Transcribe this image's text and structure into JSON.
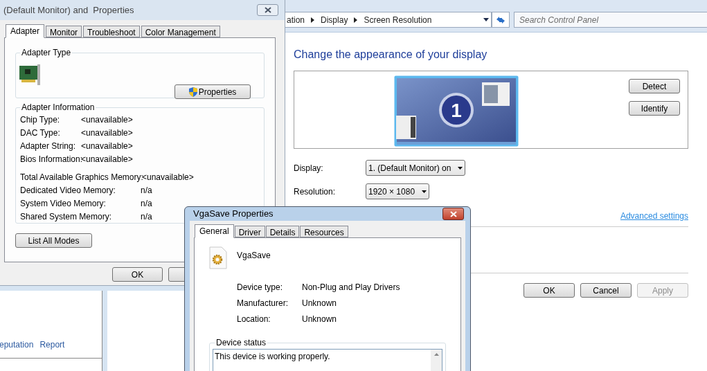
{
  "control_panel": {
    "breadcrumb": [
      "ation",
      "Display",
      "Screen Resolution"
    ],
    "search": {
      "placeholder": "Search Control Panel"
    },
    "heading": "Change the appearance of your display",
    "monitor": {
      "number": "1"
    },
    "side_buttons": [
      "Detect",
      "Identify"
    ],
    "fields": [
      {
        "label": "Display:",
        "value": "1. (Default Monitor) on"
      },
      {
        "label": "Resolution:",
        "value": "1920 × 1080"
      }
    ],
    "link": "Advanced settings",
    "buttons": [
      {
        "label": "OK",
        "disabled": false
      },
      {
        "label": "Cancel",
        "disabled": false
      },
      {
        "label": "Apply",
        "disabled": true
      }
    ]
  },
  "adapter_dialog": {
    "title": "(Default Monitor) and  Properties",
    "tabs": [
      {
        "label": "Adapter",
        "selected": true
      },
      {
        "label": "Monitor",
        "selected": false
      },
      {
        "label": "Troubleshoot",
        "selected": false
      },
      {
        "label": "Color Management",
        "selected": false
      }
    ],
    "adapter_type": {
      "legend": "Adapter Type",
      "button": "Properties"
    },
    "adapter_information": {
      "legend": "Adapter Information",
      "rows": [
        {
          "label": "Chip Type:",
          "value": "<unavailable>"
        },
        {
          "label": "DAC Type:",
          "value": "<unavailable>"
        },
        {
          "label": "Adapter String:",
          "value": "<unavailable>"
        },
        {
          "label": "Bios Information:",
          "value": "<unavailable>"
        }
      ],
      "memory_rows": [
        {
          "label": "Total Available Graphics Memory:",
          "value": "<unavailable>"
        },
        {
          "label": "Dedicated Video Memory:",
          "value": "n/a"
        },
        {
          "label": "System Video Memory:",
          "value": "n/a"
        },
        {
          "label": "Shared System Memory:",
          "value": "n/a"
        }
      ]
    },
    "list_modes_button": "List All Modes",
    "buttons": [
      "OK"
    ]
  },
  "background_window": {
    "links": [
      "eputation",
      "Report"
    ]
  },
  "device_dialog": {
    "title": "VgaSave Properties",
    "tabs": [
      {
        "label": "General",
        "selected": true
      },
      {
        "label": "Driver",
        "selected": false
      },
      {
        "label": "Details",
        "selected": false
      },
      {
        "label": "Resources",
        "selected": false
      }
    ],
    "device_name": "VgaSave",
    "rows": [
      {
        "label": "Device type:",
        "value": "Non-Plug and Play Drivers"
      },
      {
        "label": "Manufacturer:",
        "value": "Unknown"
      },
      {
        "label": "Location:",
        "value": "Unknown"
      }
    ],
    "status_legend": "Device status",
    "status_text": "This device is working properly."
  }
}
